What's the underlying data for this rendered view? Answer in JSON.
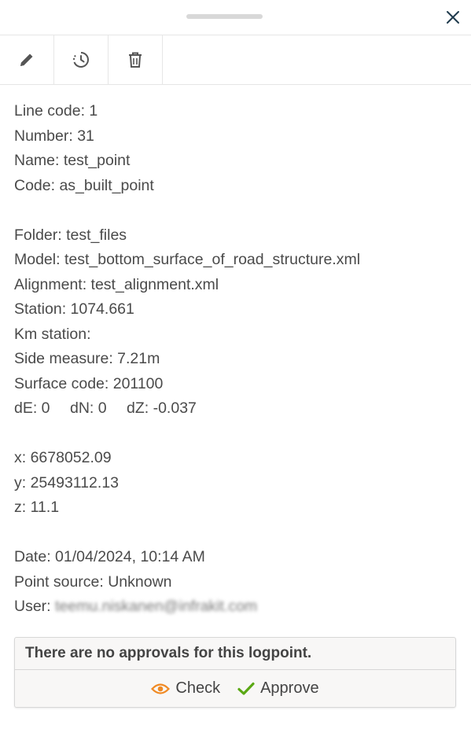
{
  "header": {
    "drag_handle": "drag-handle",
    "close_icon": "close-icon"
  },
  "toolbar": {
    "icons": [
      "pencil-icon",
      "history-icon",
      "trash-icon"
    ]
  },
  "info": {
    "line_code": "Line code: 1",
    "number": "Number: 31",
    "name": "Name: test_point",
    "code": "Code: as_built_point",
    "folder": "Folder: test_files",
    "model": "Model: test_bottom_surface_of_road_structure.xml",
    "alignment": "Alignment: test_alignment.xml",
    "station": "Station: 1074.661",
    "km_station": "Km station:",
    "side_measure": "Side measure: 7.21m",
    "surface_code": "Surface code: 201100",
    "de": "dE: 0",
    "dn": "dN: 0",
    "dz": "dZ: -0.037",
    "x": "x: 6678052.09",
    "y": "y: 25493112.13",
    "z": "z: 11.1",
    "date": "Date: 01/04/2024, 10:14 AM",
    "point_source": "Point source: Unknown",
    "user_label": "User:",
    "user_value": "teemu.niskanen@infrakit.com"
  },
  "approvals": {
    "message": "There are no approvals for this logpoint.",
    "check_label": "Check",
    "approve_label": "Approve"
  },
  "colors": {
    "accent_orange": "#f08a24",
    "approve_green": "#5aa814",
    "close_icon": "#1f3a4d"
  }
}
